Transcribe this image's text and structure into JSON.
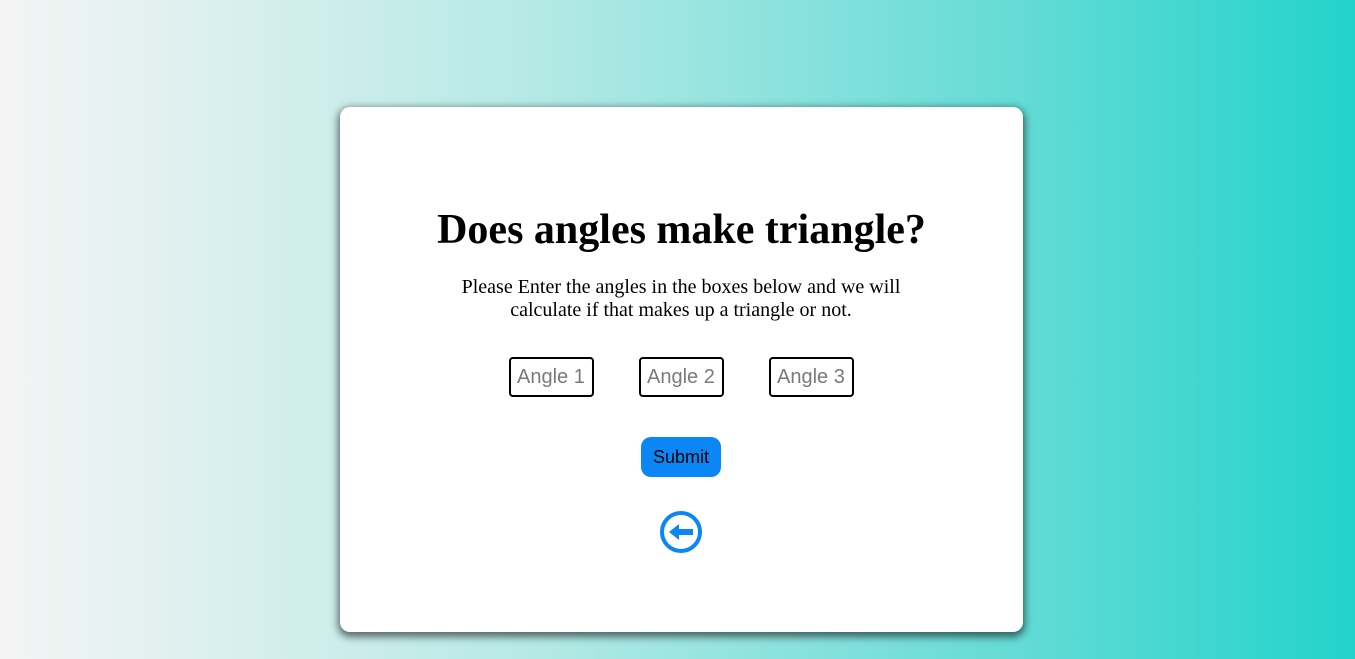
{
  "card": {
    "title": "Does angles make triangle?",
    "description": "Please Enter the angles in the boxes below and we will calculate if that makes up a triangle or not.",
    "inputs": [
      {
        "placeholder": "Angle 1",
        "value": ""
      },
      {
        "placeholder": "Angle 2",
        "value": ""
      },
      {
        "placeholder": "Angle 3",
        "value": ""
      }
    ],
    "submit_label": "Submit",
    "back_icon": "arrow-left-circle-icon"
  },
  "colors": {
    "accent": "#0a87f5",
    "background_start": "#f4f4f4",
    "background_end": "#22d3cb",
    "card": "#ffffff"
  }
}
